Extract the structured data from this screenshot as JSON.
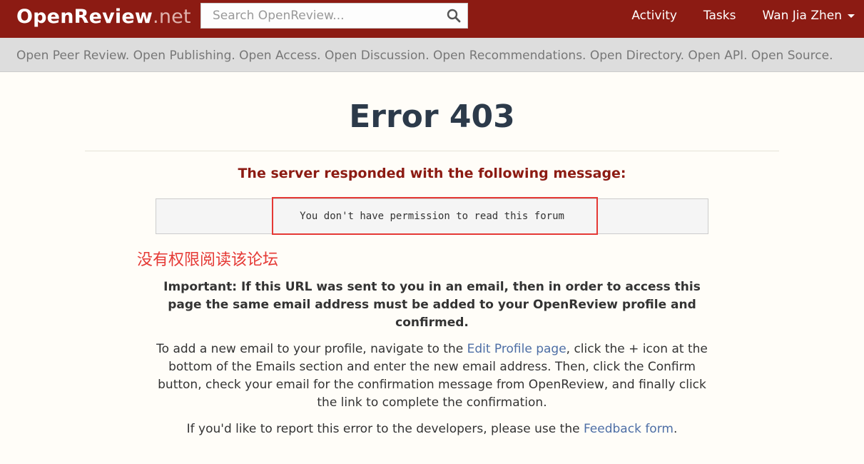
{
  "header": {
    "brand_name": "OpenReview",
    "brand_tld": ".net",
    "search_placeholder": "Search OpenReview...",
    "nav": {
      "activity": "Activity",
      "tasks": "Tasks",
      "user": "Wan Jia Zhen"
    }
  },
  "banner": {
    "text": "Open Peer Review. Open Publishing. Open Access. Open Discussion. Open Recommendations. Open Directory. Open API. Open Source."
  },
  "main": {
    "title": "Error 403",
    "subtitle": "The server responded with the following message:",
    "message": "You don't have permission to read this forum",
    "annotation": "没有权限阅读该论坛",
    "important": "Important: If this URL was sent to you in an email, then in order to access this page the same email address must be added to your OpenReview profile and confirmed.",
    "instructions_before": "To add a new email to your profile, navigate to the ",
    "edit_profile_link": "Edit Profile page",
    "instructions_after": ", click the + icon at the bottom of the Emails section and enter the new email address. Then, click the Confirm button, check your email for the confirmation message from OpenReview, and finally click the link to complete the confirmation.",
    "feedback_before": "If you'd like to report this error to the developers, please use the ",
    "feedback_link": "Feedback form",
    "feedback_after": "."
  },
  "colors": {
    "header_bg": "#8c1b13",
    "banner_bg": "#dddddd",
    "link": "#4d6ea5",
    "annotation_red": "#e53935"
  },
  "icons": {
    "search": "search-icon",
    "user_menu": "caret-down-icon"
  }
}
